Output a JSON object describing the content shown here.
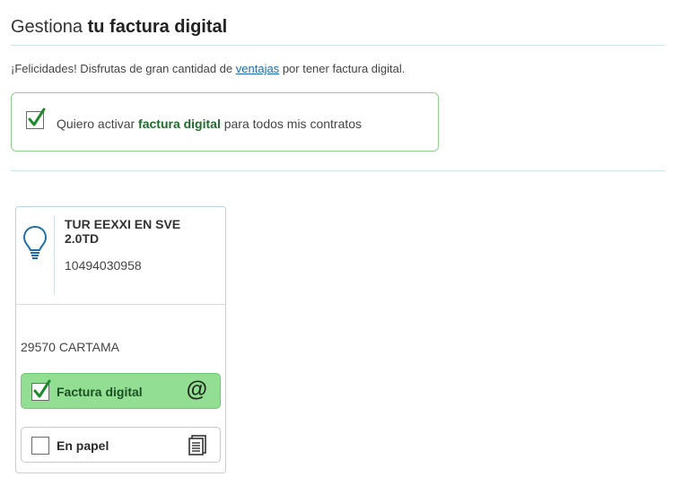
{
  "header": {
    "title_prefix": "Gestiona",
    "title_strong": "tu factura digital"
  },
  "intro": {
    "text_before": "¡Felicidades! Disfrutas de gran cantidad de",
    "link": "ventajas",
    "text_after": "por tener factura digital."
  },
  "activate": {
    "checked": true,
    "label_before": "Quiero activar",
    "label_strong": "factura digital",
    "label_after": "para todos mis contratos"
  },
  "contract": {
    "icon": "lightbulb-icon",
    "name": "TUR EEXXI EN SVE 2.0TD",
    "number": "10494030958",
    "address": "29570 CARTAMA",
    "options": {
      "digital": {
        "label": "Factura digital",
        "checked": true,
        "icon": "at-sign-icon"
      },
      "paper": {
        "label": "En papel",
        "checked": false,
        "icon": "paper-document-icon"
      }
    }
  },
  "colors": {
    "accent_green": "#92df94",
    "check_green": "#1f8a2c",
    "link_blue": "#1a6db0",
    "divider": "#cfe3ea"
  }
}
